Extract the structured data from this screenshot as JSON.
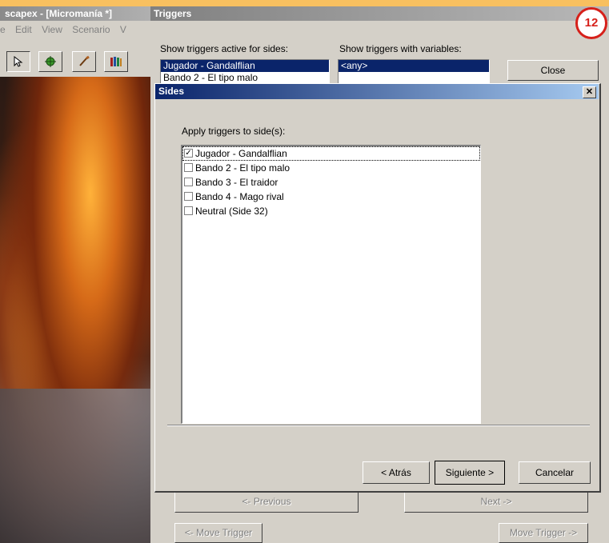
{
  "editor": {
    "title": "scapex - [Micromanía *]",
    "menu": [
      "e",
      "Edit",
      "View",
      "Scenario",
      "V"
    ]
  },
  "triggers": {
    "title": "Triggers",
    "sides_label": "Show triggers active for sides:",
    "variables_label": "Show triggers with variables:",
    "sides_list": [
      "Jugador - Gandalflian",
      "Bando 2 - El tipo malo"
    ],
    "variables_list": [
      "<any>"
    ],
    "close_label": "Close",
    "previous_label": "<- Previous",
    "next_label": "Next ->",
    "move_trigger_left_label": "<- Move Trigger",
    "move_trigger_right_label": "Move Trigger ->"
  },
  "sides_dialog": {
    "title": "Sides",
    "apply_label": "Apply triggers to side(s):",
    "items": [
      {
        "label": "Jugador - Gandalflian",
        "checked": true
      },
      {
        "label": "Bando 2 - El tipo malo",
        "checked": false
      },
      {
        "label": "Bando 3 - El traidor",
        "checked": false
      },
      {
        "label": "Bando 4 - Mago rival",
        "checked": false
      },
      {
        "label": "Neutral (Side 32)",
        "checked": false
      }
    ],
    "back_label": "< Atrás",
    "next_label": "Siguiente >",
    "cancel_label": "Cancelar"
  },
  "badge": "12",
  "colors": {
    "accent": "#0a246a",
    "frame": "#f0a23c",
    "badge": "#d6201a"
  }
}
